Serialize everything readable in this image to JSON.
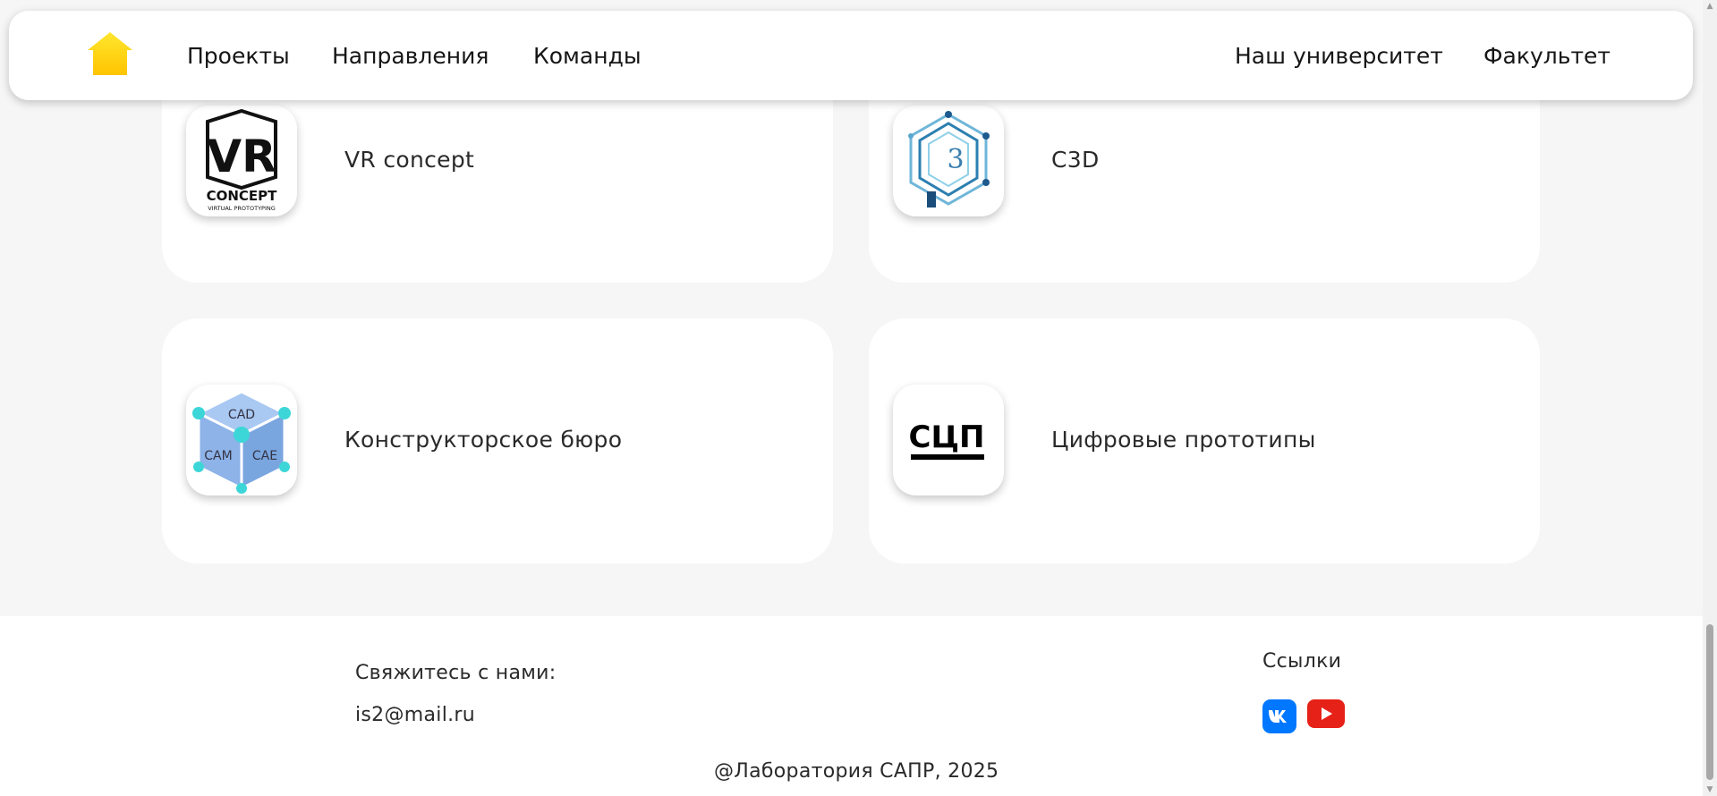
{
  "header": {
    "nav_left": [
      "Проекты",
      "Направления",
      "Команды"
    ],
    "nav_right": [
      "Наш университет",
      "Факультет"
    ],
    "home_icon": "home-icon",
    "accent": "#ffd200"
  },
  "cards": [
    {
      "title": "VR concept",
      "logo": {
        "main": "VR",
        "word": "CONCEPT",
        "sub": "VIRTUAL PROTOTYPING"
      }
    },
    {
      "title": "C3D",
      "logo": {
        "main": "3"
      }
    },
    {
      "title": "Конструкторское бюро",
      "logo": {
        "faces": [
          "CAD",
          "CAM",
          "CAE"
        ]
      }
    },
    {
      "title": "Цифровые прототипы",
      "logo": {
        "main": "СЦП"
      }
    }
  ],
  "footer": {
    "contact_heading": "Свяжитесь с нами:",
    "email": "is2@mail.ru",
    "links_heading": "Ссылки",
    "vk_icon": "vk-icon",
    "youtube_icon": "youtube-icon",
    "copyright": "@Лаборатория САПР, 2025"
  }
}
